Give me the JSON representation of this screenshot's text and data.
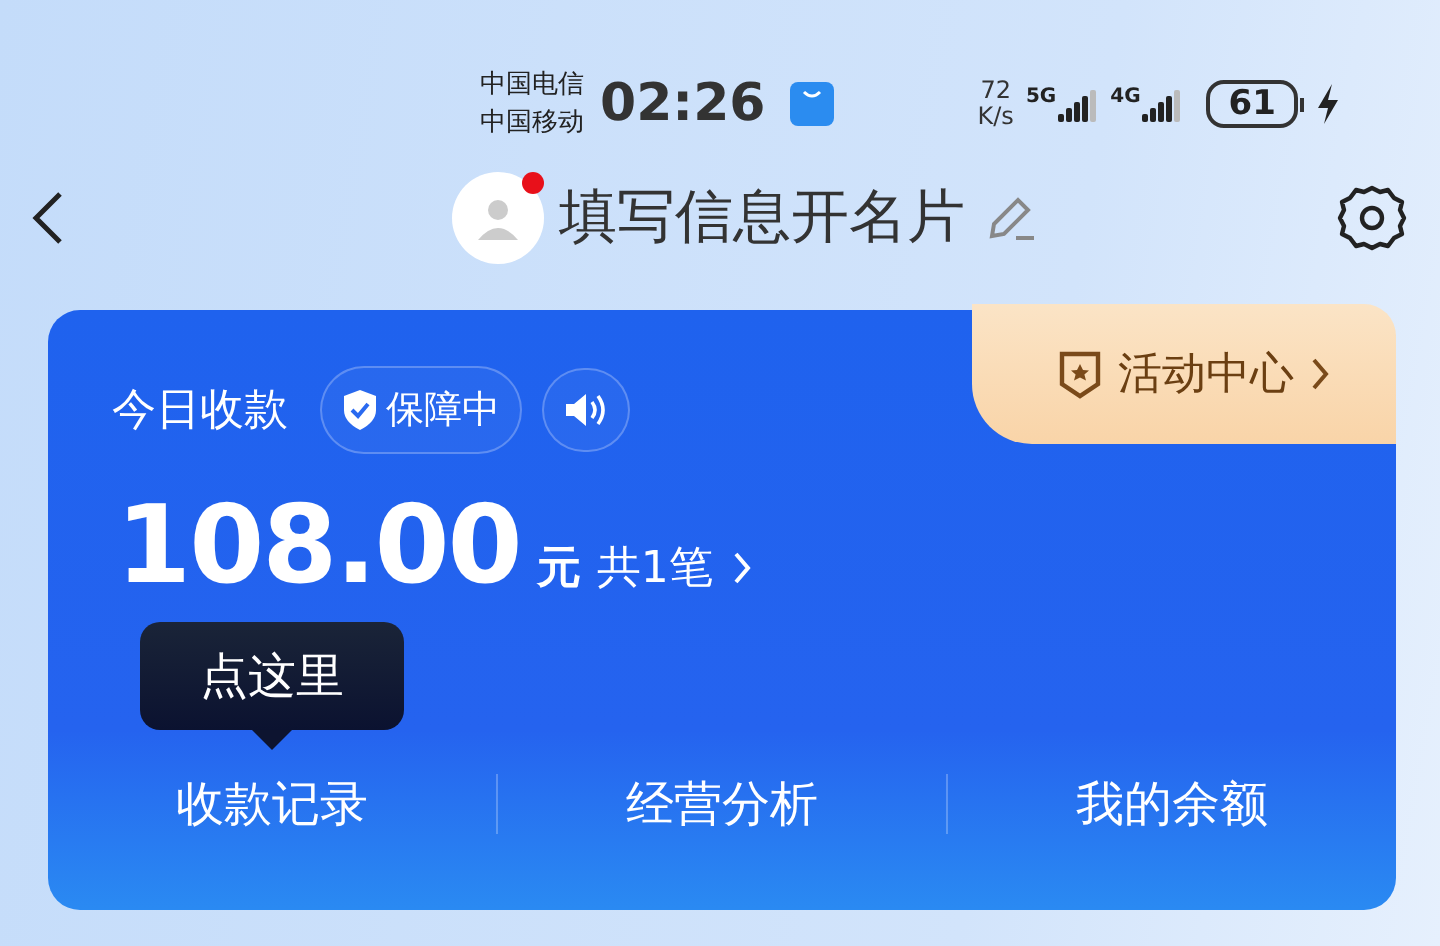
{
  "status_bar": {
    "carriers": [
      "中国电信",
      "中国移动"
    ],
    "time": "02:26",
    "speed_value": "72",
    "speed_unit": "K/s",
    "networks": [
      {
        "label": "5G",
        "level": 0.8
      },
      {
        "label": "4G",
        "level": 0.8
      }
    ],
    "battery": "61",
    "charging": true
  },
  "nav": {
    "title": "填写信息开名片",
    "avatar_dot": true
  },
  "card": {
    "label": "今日收款",
    "badge": "保障中",
    "amount": "108.00",
    "currency": "元",
    "count": "共1笔",
    "activity": "活动中心",
    "tooltip": "点这里",
    "actions": [
      "收款记录",
      "经营分析",
      "我的余额"
    ]
  }
}
